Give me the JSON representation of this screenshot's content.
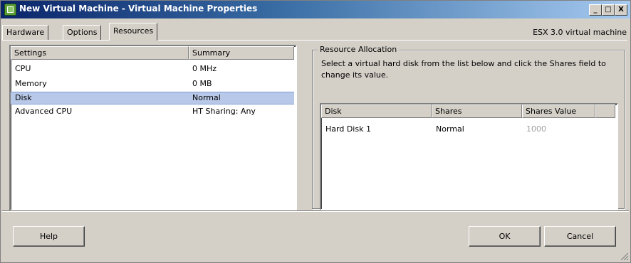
{
  "window": {
    "title": "New Virtual Machine - Virtual Machine Properties",
    "minimize": "_",
    "maximize": "□",
    "close": "X"
  },
  "tabs": [
    {
      "label": "Hardware",
      "active": false
    },
    {
      "label": "Options",
      "active": false
    },
    {
      "label": "Resources",
      "active": true
    }
  ],
  "version_label": "ESX 3.0 virtual machine",
  "settings_list": {
    "columns": [
      "Settings",
      "Summary"
    ],
    "rows": [
      {
        "setting": "CPU",
        "summary": "0 MHz",
        "selected": false
      },
      {
        "setting": "Memory",
        "summary": "0 MB",
        "selected": false
      },
      {
        "setting": "Disk",
        "summary": "Normal",
        "selected": true
      },
      {
        "setting": "Advanced CPU",
        "summary": "HT Sharing: Any",
        "selected": false
      }
    ]
  },
  "resource_allocation": {
    "group_title": "Resource Allocation",
    "description": "Select a virtual hard disk from the list below and click the Shares field to change its value.",
    "columns": [
      "Disk",
      "Shares",
      "Shares Value"
    ],
    "rows": [
      {
        "disk": "Hard Disk 1",
        "shares": "Normal",
        "shares_value": "1000"
      }
    ]
  },
  "buttons": {
    "help": "Help",
    "ok": "OK",
    "cancel": "Cancel"
  },
  "colors": {
    "title_bar_start": "#0a246a",
    "title_bar_end": "#a6caf0",
    "selection": "#b8c8e8",
    "dialog_face": "#d4d0c8",
    "disabled_text": "#a0a0a0"
  }
}
